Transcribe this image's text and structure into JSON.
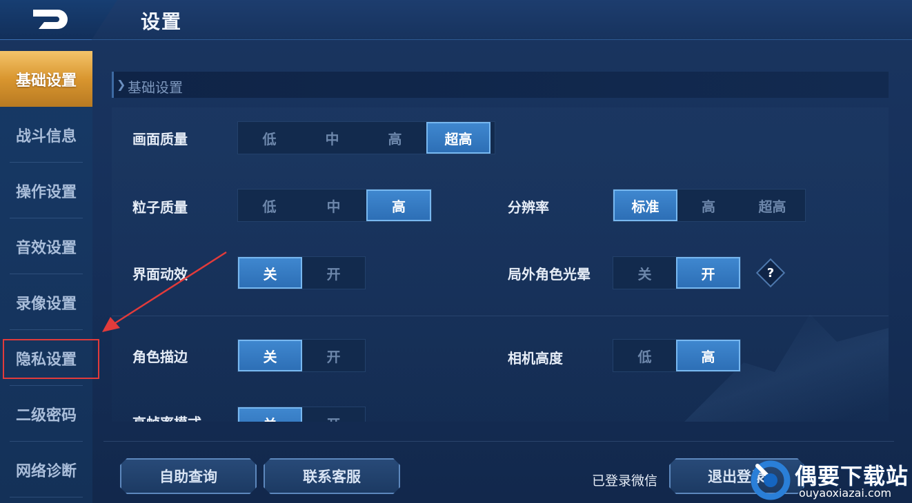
{
  "header": {
    "title": "设置"
  },
  "sidebar": {
    "items": [
      {
        "label": "基础设置",
        "active": true
      },
      {
        "label": "战斗信息"
      },
      {
        "label": "操作设置"
      },
      {
        "label": "音效设置"
      },
      {
        "label": "录像设置"
      },
      {
        "label": "隐私设置",
        "highlighted": true
      },
      {
        "label": "二级密码"
      },
      {
        "label": "网络诊断"
      }
    ]
  },
  "section": {
    "title": "基础设置"
  },
  "settings": {
    "graphics_quality": {
      "label": "画面质量",
      "options": [
        "低",
        "中",
        "高",
        "超高"
      ],
      "selected": "超高"
    },
    "particle_quality": {
      "label": "粒子质量",
      "options": [
        "低",
        "中",
        "高"
      ],
      "selected": "高"
    },
    "resolution": {
      "label": "分辨率",
      "options": [
        "标准",
        "高",
        "超高"
      ],
      "selected": "标准"
    },
    "ui_animation": {
      "label": "界面动效",
      "options": [
        "关",
        "开"
      ],
      "selected": "关"
    },
    "outer_glow": {
      "label": "局外角色光晕",
      "options": [
        "关",
        "开"
      ],
      "selected": "开",
      "help": "?"
    },
    "character_outline": {
      "label": "角色描边",
      "options": [
        "关",
        "开"
      ],
      "selected": "关"
    },
    "camera_height": {
      "label": "相机高度",
      "options": [
        "低",
        "高"
      ],
      "selected": "高"
    },
    "high_fps": {
      "label": "高帧率模式",
      "options": [
        "关",
        "开"
      ],
      "selected": "关"
    }
  },
  "footer": {
    "self_service_label": "自助查询",
    "contact_label": "联系客服",
    "logged_in_text": "已登录微信",
    "logout_label": "退出登录"
  },
  "watermark": {
    "title": "偶要下载站",
    "subtitle": "ouyaoxiazai.com"
  },
  "colors": {
    "accent": "#2d6fb6",
    "active_tab": "#d9962f",
    "highlight": "#e23b3b"
  }
}
